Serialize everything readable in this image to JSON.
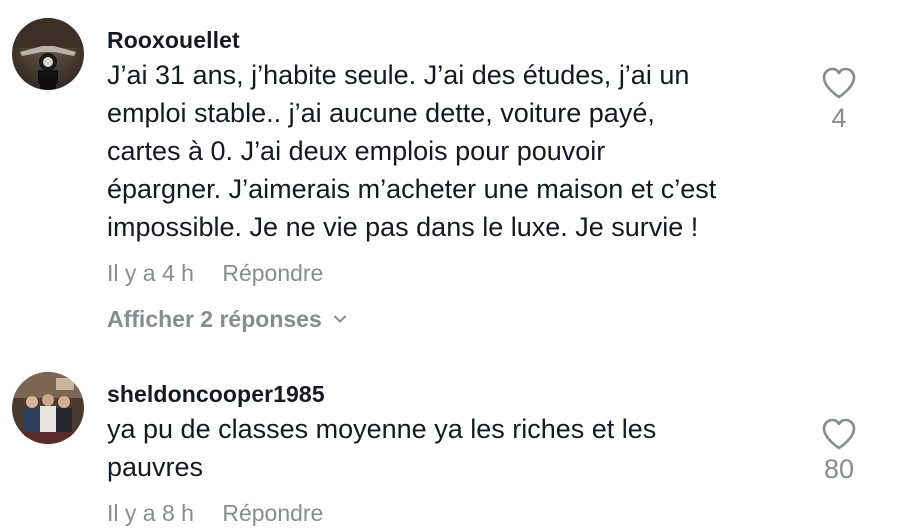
{
  "comments": [
    {
      "username": "Rooxouellet",
      "text": "J’ai 31 ans, j’habite seule. J’ai des études, j’ai un\nemploi stable.. j’ai aucune dette, voiture payé,\ncartes à 0. J’ai deux emplois pour pouvoir\népargner. J’aimerais m’acheter une maison et c’est\nimpossible. Je ne vie pas dans le luxe. Je survie !",
      "time": "Il y a 4 h",
      "reply_label": "Répondre",
      "view_replies_label": "Afficher 2 réponses",
      "like_count": "4",
      "avatar_icon": "motorcycle-photo"
    },
    {
      "username": "sheldoncooper1985",
      "text": "ya pu de classes moyenne ya les riches et les\npauvres",
      "time": "Il y a 8 h",
      "reply_label": "Répondre",
      "like_count": "80",
      "avatar_icon": "group-photo"
    }
  ],
  "icons": {
    "like": "heart-outline-icon",
    "expand": "chevron-down-icon"
  },
  "colors": {
    "text": "#161823",
    "secondary": "#8a8b91",
    "background": "#ffffff"
  }
}
